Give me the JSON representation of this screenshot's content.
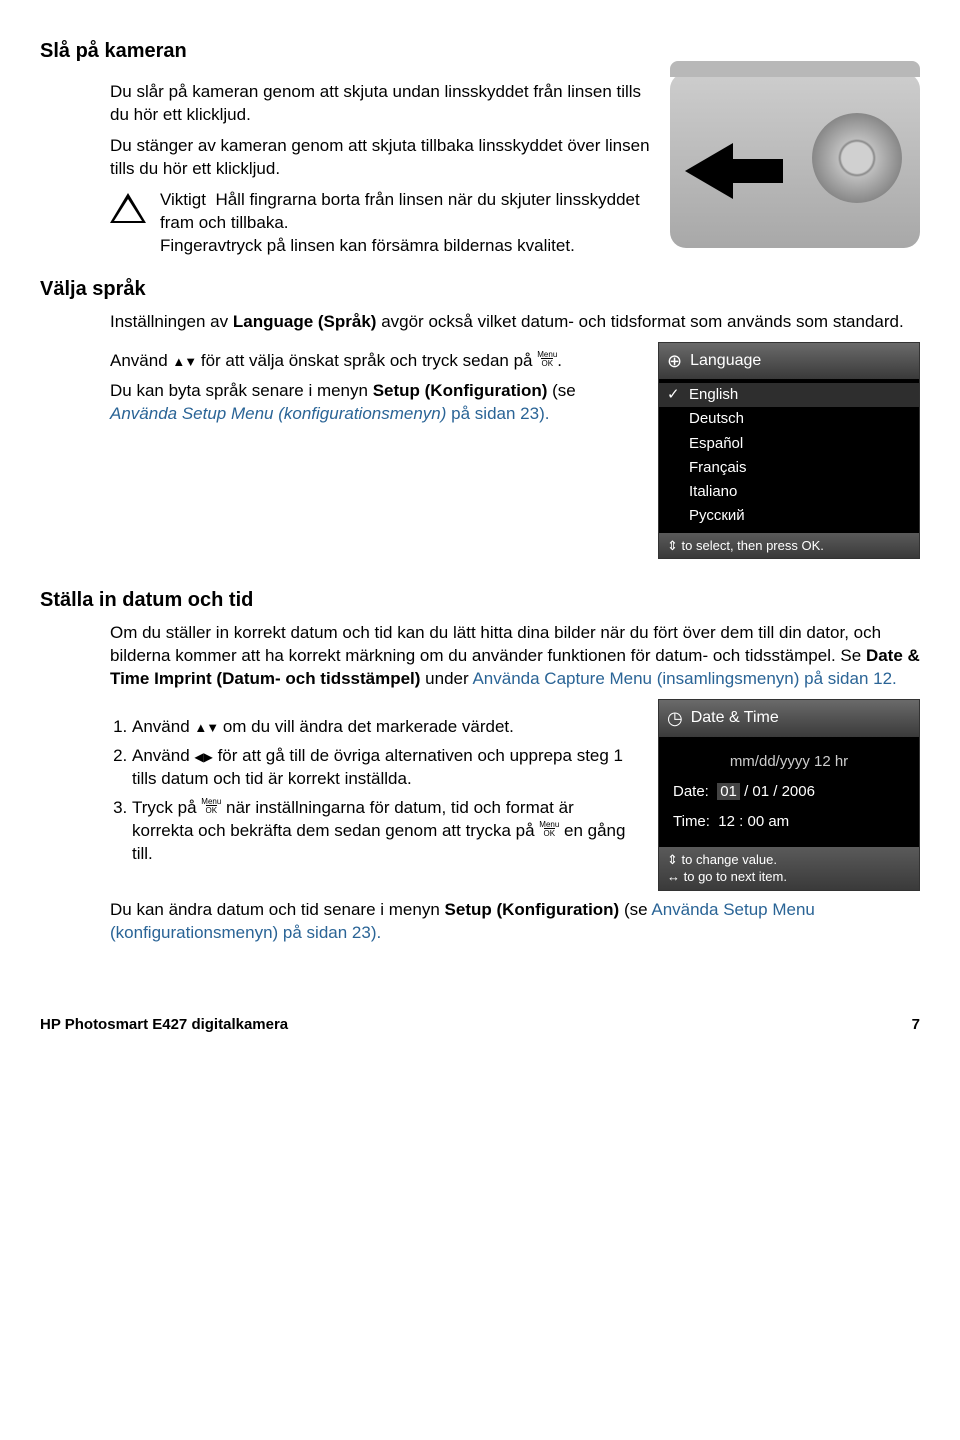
{
  "sections": {
    "turnon": {
      "title": "Slå på kameran",
      "p1": "Du slår på kameran genom att skjuta undan linsskyddet från linsen tills du hör ett klickljud.",
      "p2": "Du stänger av kameran genom att skjuta tillbaka linsskyddet över linsen tills du hör ett klickljud.",
      "warn_label": "Viktigt",
      "warn_text1": "Håll fingrarna borta från linsen när du skjuter linsskyddet fram och tillbaka.",
      "warn_text2": "Fingeravtryck på linsen kan försämra bildernas kvalitet."
    },
    "language": {
      "title": "Välja språk",
      "intro_a": "Inställningen av ",
      "intro_b": "Language (Språk)",
      "intro_c": " avgör också vilket datum- och tidsformat som används som standard.",
      "use_a": "Använd ",
      "use_b": " för att välja önskat språk och tryck sedan på ",
      "later_a": "Du kan byta språk senare i menyn ",
      "later_b": "Setup (Konfiguration)",
      "later_c": " (se ",
      "later_link": "Använda Setup Menu (konfigurationsmenyn)",
      "later_d": " på sidan 23).",
      "menu": {
        "header": "Language",
        "items": [
          "English",
          "Deutsch",
          "Español",
          "Français",
          "Italiano",
          "Русский"
        ],
        "footer": "to select, then press OK."
      }
    },
    "datetime": {
      "title": "Ställa in datum och tid",
      "p1_a": "Om du ställer in korrekt datum och tid kan du lätt hitta dina bilder när du fört över dem till din dator, och bilderna kommer att ha korrekt märkning om du använder funktionen för datum- och tidsstämpel. Se ",
      "p1_b": "Date & Time Imprint (Datum- och tidsstämpel)",
      "p1_c": " under ",
      "p1_link": "Använda Capture Menu (insamlingsmenyn)",
      "p1_d": " på sidan 12.",
      "steps": {
        "s1_a": "Använd ",
        "s1_b": " om du vill ändra det markerade värdet.",
        "s2_a": "Använd ",
        "s2_b": " för att gå till de övriga alternativen och upprepa steg 1 tills datum och tid är korrekt inställda.",
        "s3_a": "Tryck på ",
        "s3_b": " när inställningarna för datum, tid och format är korrekta och bekräfta dem sedan genom att trycka på ",
        "s3_c": " en gång till."
      },
      "later_a": "Du kan ändra datum och tid senare i menyn ",
      "later_b": "Setup (Konfiguration)",
      "later_c": " (se ",
      "later_link": "Använda Setup Menu (konfigurationsmenyn)",
      "later_d": " på sidan 23).",
      "screen": {
        "header": "Date & Time",
        "format": "mm/dd/yyyy  12 hr",
        "date_label": "Date:",
        "date_val_a": "01",
        "date_val_b": "/ 01 / 2006",
        "time_label": "Time:",
        "time_val": "12 : 00  am",
        "footer1": "to change value.",
        "footer2": "to go to next item."
      }
    }
  },
  "menuok": {
    "top": "Menu",
    "bottom": "OK"
  },
  "footer": {
    "left": "HP Photosmart E427 digitalkamera",
    "right": "7"
  }
}
